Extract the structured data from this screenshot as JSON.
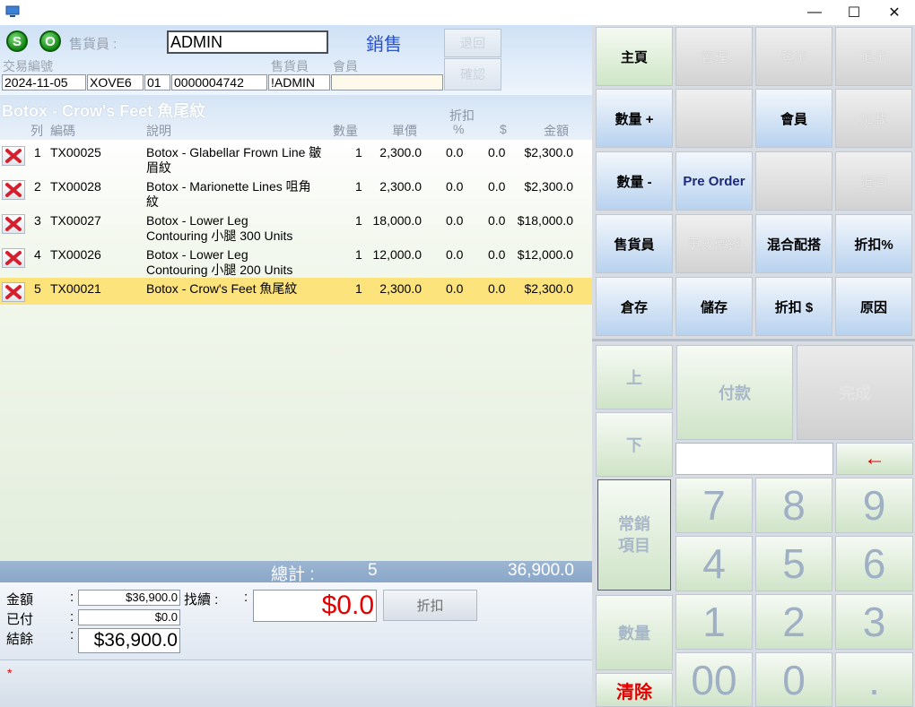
{
  "window": {
    "minimize": "—",
    "maximize": "☐",
    "close": "✕"
  },
  "header": {
    "s_button": "S",
    "o_button": "O",
    "salesperson_label": "售貨員 :",
    "salesperson_value": "ADMIN",
    "mode_title": "銷售",
    "return_button": "退回",
    "confirm_button": "確認",
    "txn_no_label": "交易編號",
    "salesperson_label2": "售貨員",
    "member_label": "會員",
    "date": "2024-11-05",
    "shop_code": "XOVE6",
    "terminal": "01",
    "txn_number": "0000004742",
    "salesperson_code": "!ADMIN",
    "member_value": ""
  },
  "list": {
    "current_item_title": "Botox - Crow's Feet 魚尾紋",
    "columns": {
      "row": "列",
      "code": "編碼",
      "desc": "說明",
      "qty": "數量",
      "price": "單價",
      "disc_top": "折扣",
      "disc_pct": "%",
      "disc_amt": "$",
      "amount": "金額"
    },
    "rows": [
      {
        "no": "1",
        "code": "TX00025",
        "desc": "Botox - Glabellar Frown Line 皺眉紋",
        "qty": "1",
        "price": "2,300.0",
        "pct": "0.0",
        "amt": "0.0",
        "total": "$2,300.0"
      },
      {
        "no": "2",
        "code": "TX00028",
        "desc": "Botox - Marionette Lines 咀角紋",
        "qty": "1",
        "price": "2,300.0",
        "pct": "0.0",
        "amt": "0.0",
        "total": "$2,300.0"
      },
      {
        "no": "3",
        "code": "TX00027",
        "desc": "Botox - Lower Leg Contouring 小腿 300 Units",
        "qty": "1",
        "price": "18,000.0",
        "pct": "0.0",
        "amt": "0.0",
        "total": "$18,000.0"
      },
      {
        "no": "4",
        "code": "TX00026",
        "desc": "Botox - Lower Leg Contouring 小腿 200 Units",
        "qty": "1",
        "price": "12,000.0",
        "pct": "0.0",
        "amt": "0.0",
        "total": "$12,000.0"
      },
      {
        "no": "5",
        "code": "TX00021",
        "desc": "Botox - Crow's Feet 魚尾紋",
        "qty": "1",
        "price": "2,300.0",
        "pct": "0.0",
        "amt": "0.0",
        "total": "$2,300.0"
      }
    ],
    "selected_row": 5
  },
  "totals": {
    "label": "總計 :",
    "count": "5",
    "amount": "36,900.0"
  },
  "summary": {
    "amount_label": "金額",
    "paid_label": "已付",
    "balance_label": "結餘",
    "colon": ":",
    "amount_value": "$36,900.0",
    "paid_value": "$0.0",
    "balance_value": "$36,900.0",
    "change_label": "找續 :",
    "change_colon": ":",
    "change_value": "$0.0",
    "discount_button": "折扣",
    "footer_mark": "*"
  },
  "function_buttons": [
    {
      "label": "主頁",
      "style": "green"
    },
    {
      "label": "管理",
      "style": "grey"
    },
    {
      "label": "登出",
      "style": "grey"
    },
    {
      "label": "退出",
      "style": "grey"
    },
    {
      "label": "數量 +",
      "style": "blue"
    },
    {
      "label": "",
      "style": "grey"
    },
    {
      "label": "會員",
      "style": "blue"
    },
    {
      "label": "加載",
      "style": "grey"
    },
    {
      "label": "數量 -",
      "style": "blue"
    },
    {
      "label": "Pre Order",
      "style": "blue"
    },
    {
      "label": "",
      "style": "grey"
    },
    {
      "label": "退回",
      "style": "grey"
    },
    {
      "label": "售貨員",
      "style": "blue"
    },
    {
      "label": "更改價錢",
      "style": "grey"
    },
    {
      "label": "混合配搭",
      "style": "blue"
    },
    {
      "label": "折扣%",
      "style": "blue"
    },
    {
      "label": "倉存",
      "style": "blue"
    },
    {
      "label": "儲存",
      "style": "blue"
    },
    {
      "label": "折扣 $",
      "style": "blue"
    },
    {
      "label": "原因",
      "style": "blue"
    }
  ],
  "keypad": {
    "up": "上",
    "down": "下",
    "pay": "付款",
    "complete": "完成",
    "backspace": "←",
    "common_items": "常銷項目",
    "quantity": "數量",
    "clear": "清除",
    "input_value": "",
    "digits": [
      "7",
      "8",
      "9",
      "4",
      "5",
      "6",
      "1",
      "2",
      "3",
      "00",
      "0",
      "."
    ]
  }
}
